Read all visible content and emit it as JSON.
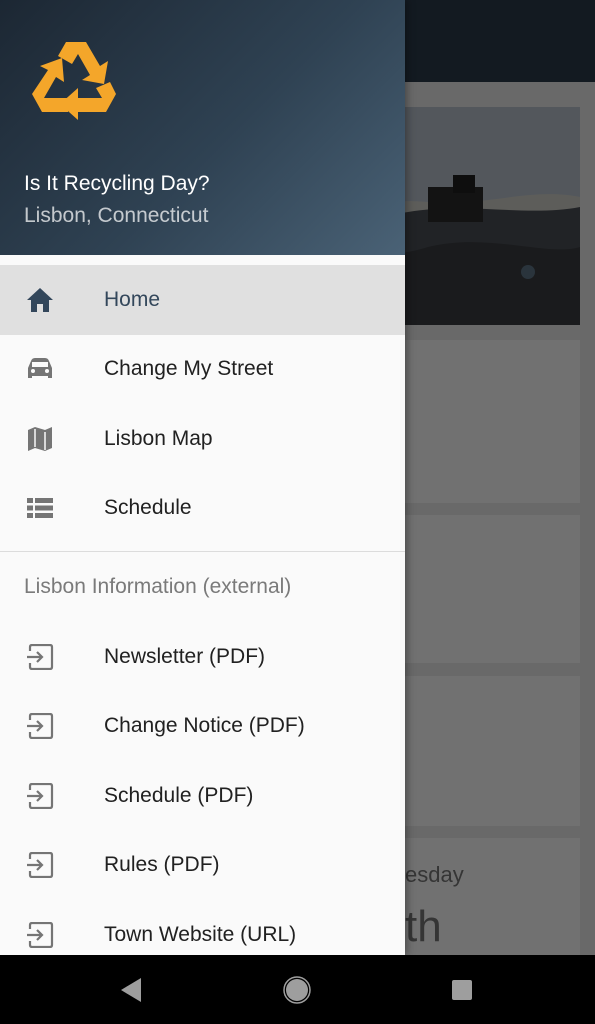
{
  "header": {
    "app_title": "Is It Recycling Day?",
    "location": "Lisbon, Connecticut",
    "logo_icon": "recycle-icon",
    "accent_color": "#f4a62a"
  },
  "menu": {
    "primary": [
      {
        "label": "Home",
        "icon": "home-icon",
        "selected": true
      },
      {
        "label": "Change My Street",
        "icon": "car-icon",
        "selected": false
      },
      {
        "label": "Lisbon Map",
        "icon": "map-icon",
        "selected": false
      },
      {
        "label": "Schedule",
        "icon": "list-icon",
        "selected": false
      }
    ],
    "section_title": "Lisbon Information (external)",
    "external": [
      {
        "label": "Newsletter (PDF)",
        "icon": "open-external-icon"
      },
      {
        "label": "Change Notice (PDF)",
        "icon": "open-external-icon"
      },
      {
        "label": "Schedule (PDF)",
        "icon": "open-external-icon"
      },
      {
        "label": "Rules (PDF)",
        "icon": "open-external-icon"
      },
      {
        "label": "Town Website (URL)",
        "icon": "open-external-icon"
      }
    ]
  },
  "background": {
    "day_fragment": "esday",
    "big_fragment": "th"
  },
  "navbar": {
    "back_icon": "back-triangle-icon",
    "home_icon": "home-circle-icon",
    "recents_icon": "recents-square-icon"
  }
}
